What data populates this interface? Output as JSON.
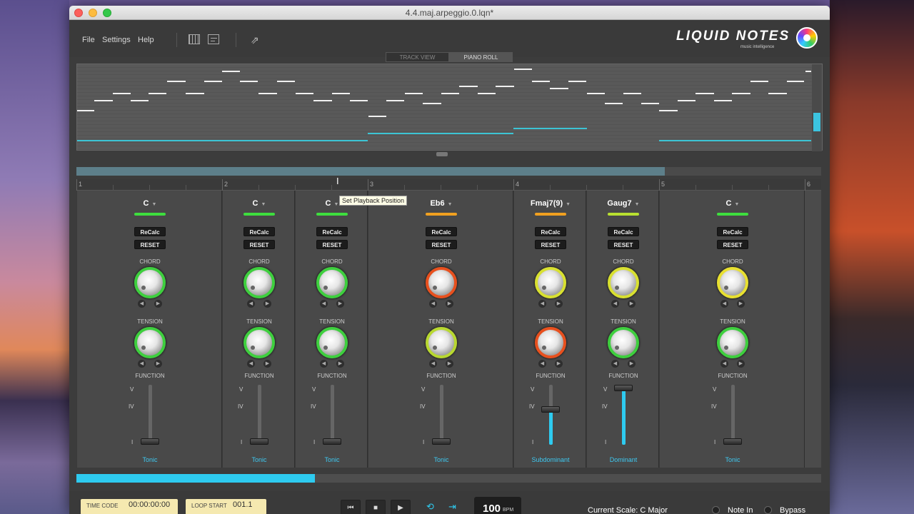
{
  "window": {
    "title": "4.4.maj.arpeggio.0.lqn*"
  },
  "menu": {
    "file": "File",
    "settings": "Settings",
    "help": "Help"
  },
  "toolbar": {
    "icons": [
      "piano-keys-icon",
      "chord-grid-icon",
      "share-icon"
    ],
    "share_glyph": "⇗"
  },
  "logo": {
    "text": "LIQUID NOTES",
    "tagline": "music intelligence"
  },
  "view_tabs": [
    {
      "label": "TRACK VIEW",
      "active": false
    },
    {
      "label": "PIANO ROLL",
      "active": true
    }
  ],
  "ruler": {
    "bars": [
      "1",
      "2",
      "3",
      "4",
      "5",
      "6"
    ]
  },
  "tooltip": {
    "text": "Set Playback Position"
  },
  "chord_lanes": [
    {
      "chord": "C",
      "chord_color": "#3ede3e",
      "recalc": "ReCalc",
      "reset": "RESET",
      "chord_label": "CHORD",
      "chord_knob_color": "#3ecf3e",
      "tension_label": "TENSION",
      "tension_knob_color": "#3ecf3e",
      "function_label": "FUNCTION",
      "function_level": 0,
      "function_name": "Tonic"
    },
    {
      "chord": "C",
      "chord_color": "#3ede3e",
      "recalc": "ReCalc",
      "reset": "RESET",
      "chord_label": "CHORD",
      "chord_knob_color": "#3ecf3e",
      "tension_label": "TENSION",
      "tension_knob_color": "#3ecf3e",
      "function_label": "FUNCTION",
      "function_level": 0,
      "function_name": "Tonic"
    },
    {
      "chord": "C",
      "chord_color": "#3ede3e",
      "recalc": "ReCalc",
      "reset": "RESET",
      "chord_label": "CHORD",
      "chord_knob_color": "#3ecf3e",
      "tension_label": "TENSION",
      "tension_knob_color": "#3ecf3e",
      "function_label": "FUNCTION",
      "function_level": 0,
      "function_name": "Tonic"
    },
    {
      "chord": "Eb6",
      "chord_color": "#f0a020",
      "recalc": "ReCalc",
      "reset": "RESET",
      "chord_label": "CHORD",
      "chord_knob_color": "#e8501e",
      "tension_label": "TENSION",
      "tension_knob_color": "#b8d830",
      "function_label": "FUNCTION",
      "function_level": 0,
      "function_name": "Tonic"
    },
    {
      "chord": "Fmaj7(9)",
      "chord_color": "#f0a020",
      "recalc": "ReCalc",
      "reset": "RESET",
      "chord_label": "CHORD",
      "chord_knob_color": "#d8e030",
      "tension_label": "TENSION",
      "tension_knob_color": "#e8501e",
      "function_label": "FUNCTION",
      "function_level": 0.6,
      "function_name": "Subdominant"
    },
    {
      "chord": "Gaug7",
      "chord_color": "#b8e030",
      "recalc": "ReCalc",
      "reset": "RESET",
      "chord_label": "CHORD",
      "chord_knob_color": "#d8e030",
      "tension_label": "TENSION",
      "tension_knob_color": "#3ecf3e",
      "function_label": "FUNCTION",
      "function_level": 1,
      "function_name": "Dominant"
    },
    {
      "chord": "C",
      "chord_color": "#3ede3e",
      "recalc": "ReCalc",
      "reset": "RESET",
      "chord_label": "CHORD",
      "chord_knob_color": "#e8e030",
      "tension_label": "TENSION",
      "tension_knob_color": "#3ecf3e",
      "function_label": "FUNCTION",
      "function_level": 0,
      "function_name": "Tonic"
    }
  ],
  "function_scale": [
    "V",
    "IV",
    "I"
  ],
  "playback_progress": 0.32,
  "loop_region": 0.79,
  "transport": {
    "timecode_label": "TIME CODE",
    "timecode_value": "00:00:00:00",
    "loopstart_label": "LOOP START",
    "loopstart_value": "001.1",
    "rewind_glyph": "⏮",
    "stop_glyph": "■",
    "play_glyph": "▶",
    "loop_glyph": "⟲",
    "follow_glyph": "⇥",
    "bpm_value": "100",
    "bpm_unit": "BPM",
    "current_scale": "Current Scale: C Major",
    "note_in": "Note In",
    "bypass": "Bypass"
  },
  "colors": {
    "accent": "#2ecbf0",
    "panel": "#3c3c3c"
  }
}
